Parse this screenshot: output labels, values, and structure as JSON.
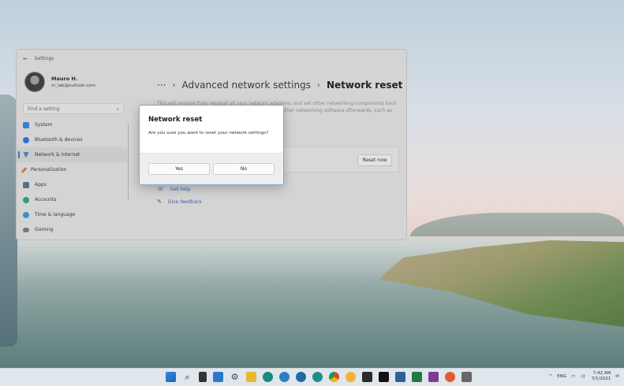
{
  "window": {
    "title": "Settings",
    "user_name": "Mauro H.",
    "user_email": "m_lab@outlook.com",
    "search_placeholder": "Find a setting",
    "nav": [
      {
        "label": "System",
        "icon": "system-icon",
        "color": "#3b7bd6"
      },
      {
        "label": "Bluetooth & devices",
        "icon": "bluetooth-icon",
        "color": "#2f6fd1"
      },
      {
        "label": "Network & internet",
        "icon": "network-icon",
        "color": "#4a7fc0"
      },
      {
        "label": "Personalization",
        "icon": "brush-icon",
        "color": "#d2734b"
      },
      {
        "label": "Apps",
        "icon": "apps-icon",
        "color": "#5b6f86"
      },
      {
        "label": "Accounts",
        "icon": "accounts-icon",
        "color": "#2c9c84"
      },
      {
        "label": "Time & language",
        "icon": "globe-icon",
        "color": "#3d8fd0"
      },
      {
        "label": "Gaming",
        "icon": "gaming-icon",
        "color": "#777777"
      }
    ],
    "breadcrumb": {
      "dots": "···",
      "parent": "Advanced network settings",
      "current": "Network reset"
    },
    "description": "This will remove then reinstall all your network adapters, and set other networking components back to their original settings. You might need to reinstall other networking software afterwards, such as VPN",
    "reset_button": "Reset now",
    "get_help": "Get help",
    "give_feedback": "Give feedback"
  },
  "dialog": {
    "title": "Network reset",
    "message": "Are you sure you want to reset your network settings?",
    "yes": "Yes",
    "no": "No"
  },
  "taskbar": {
    "tray_lang": "ENG",
    "time": "7:42 AM",
    "date": "7/1/2021"
  }
}
